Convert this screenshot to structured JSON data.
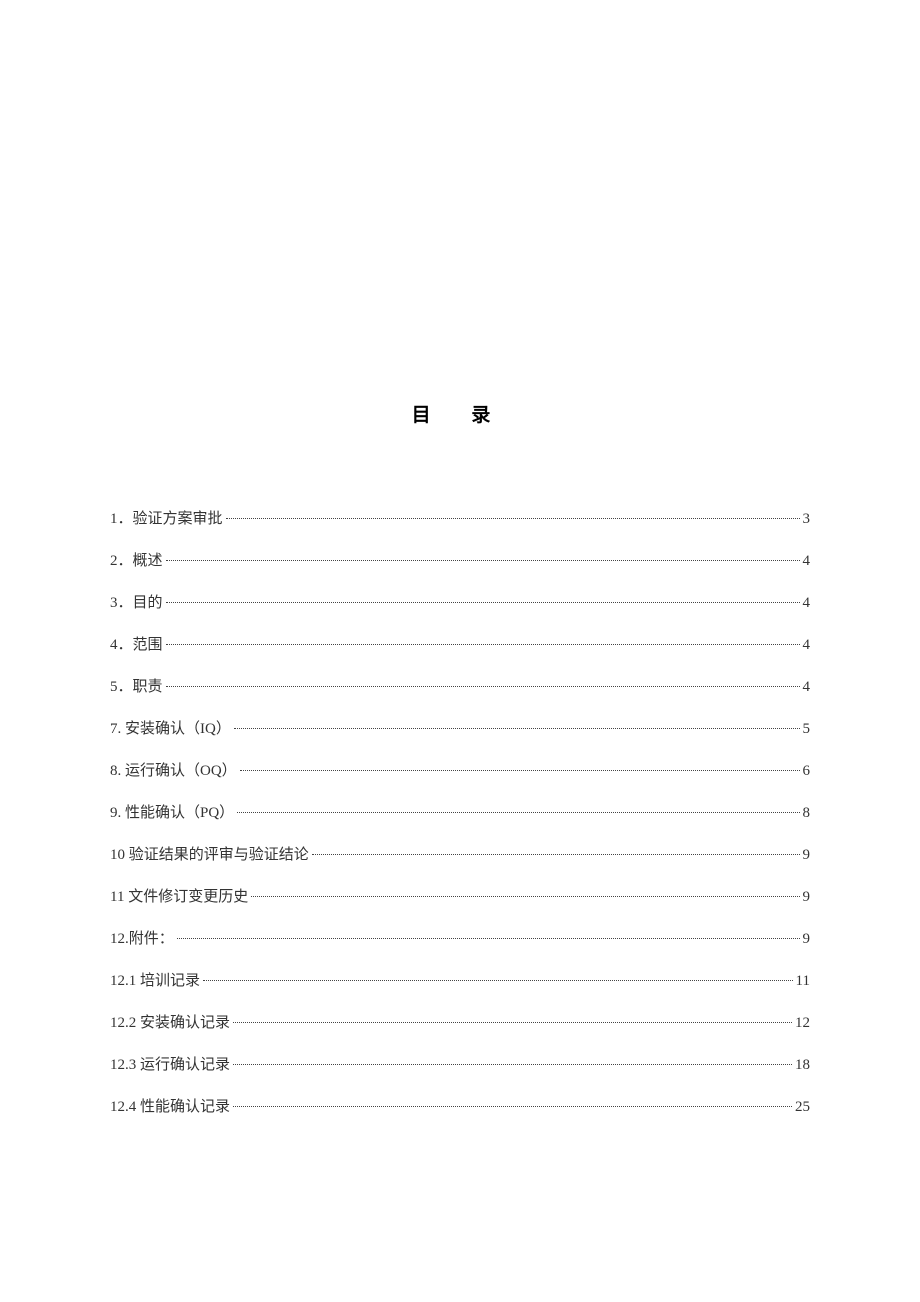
{
  "title": "目 录",
  "toc": [
    {
      "label": "1．验证方案审批",
      "page": "3"
    },
    {
      "label": "2．概述",
      "page": "4"
    },
    {
      "label": "3．目的",
      "page": "4"
    },
    {
      "label": "4．范围",
      "page": "4"
    },
    {
      "label": "5．职责",
      "page": "4"
    },
    {
      "label": "7. 安装确认（IQ）",
      "page": "5"
    },
    {
      "label": "8. 运行确认（OQ）",
      "page": "6"
    },
    {
      "label": "9. 性能确认（PQ）",
      "page": "8"
    },
    {
      "label": "10 验证结果的评审与验证结论",
      "page": "9"
    },
    {
      "label": "11 文件修订变更历史",
      "page": "9"
    },
    {
      "label": "12.附件：",
      "page": "9"
    },
    {
      "label": "12.1 培训记录",
      "page": "11"
    },
    {
      "label": "12.2 安装确认记录",
      "page": "12"
    },
    {
      "label": "12.3 运行确认记录",
      "page": "18"
    },
    {
      "label": "12.4 性能确认记录",
      "page": "25"
    }
  ]
}
